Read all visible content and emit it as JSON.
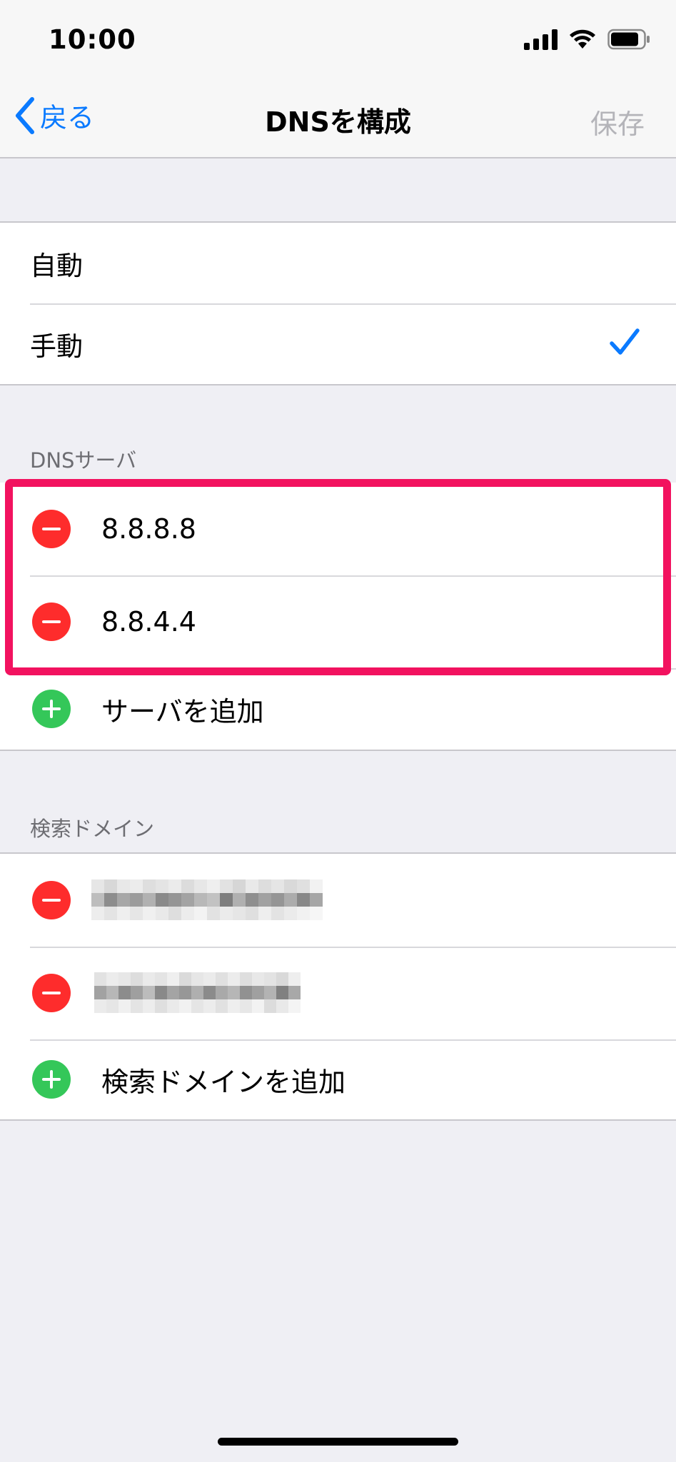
{
  "status_bar": {
    "time": "10:00"
  },
  "nav": {
    "back_label": "戻る",
    "title": "DNSを構成",
    "save_label": "保存"
  },
  "mode": {
    "options": [
      {
        "label": "自動",
        "selected": false
      },
      {
        "label": "手動",
        "selected": true
      }
    ]
  },
  "dns_servers": {
    "header": "DNSサーバ",
    "servers": [
      "8.8.8.8",
      "8.8.4.4"
    ],
    "add_label": "サーバを追加"
  },
  "search_domains": {
    "header": "検索ドメイン",
    "add_label": "検索ドメインを追加"
  },
  "colors": {
    "accent": "#0a7aff",
    "delete": "#fe2c2c",
    "add": "#34c759",
    "highlight": "#f2125f"
  }
}
